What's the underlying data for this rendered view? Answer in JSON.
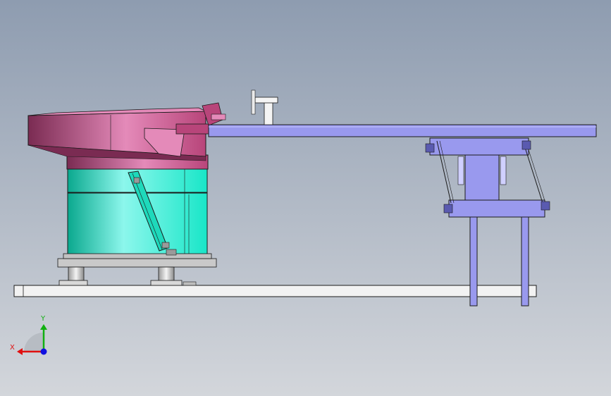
{
  "viewport": {
    "background_top": "#8e9cb0",
    "background_bottom": "#d3d6db"
  },
  "colors": {
    "bowl_magenta": "#b8457a",
    "bowl_magenta_light": "#e48ab9",
    "bowl_magenta_dark": "#7a2b52",
    "drive_cyan": "#19e6c8",
    "drive_cyan_light": "#8cf7ec",
    "drive_cyan_dark": "#0aa88e",
    "linear_feeder_blue": "#9999ee",
    "linear_feeder_dark": "#5a5ab0",
    "base_plate": "#f2f2f2",
    "outline": "#1a1a1a",
    "axis_x": "#e01010",
    "axis_y": "#10b010",
    "axis_z": "#1010e0"
  },
  "triad": {
    "x_label": "X",
    "y_label": "Y",
    "x_icon": "x-axis-arrow-icon",
    "y_icon": "y-axis-arrow-icon",
    "z_icon": "z-axis-dot-icon"
  }
}
